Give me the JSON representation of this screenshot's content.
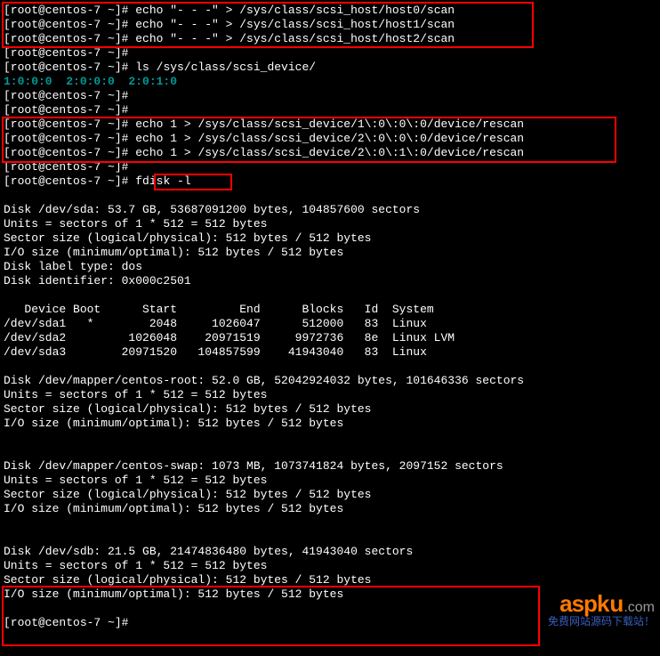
{
  "prompt": {
    "user": "root",
    "host": "centos-7",
    "path": "~",
    "hash": "#"
  },
  "commands": {
    "scan0": "echo \"- - -\" > /sys/class/scsi_host/host0/scan",
    "scan1": "echo \"- - -\" > /sys/class/scsi_host/host1/scan",
    "scan2": "echo \"- - -\" > /sys/class/scsi_host/host2/scan",
    "ls": "ls /sys/class/scsi_device/",
    "ls_output": "1:0:0:0  2:0:0:0  2:0:1:0",
    "rescan0": "echo 1 > /sys/class/scsi_device/1\\:0\\:0\\:0/device/rescan",
    "rescan1": "echo 1 > /sys/class/scsi_device/2\\:0\\:0\\:0/device/rescan",
    "rescan2": "echo 1 > /sys/class/scsi_device/2\\:0\\:1\\:0/device/rescan",
    "fdisk": "fdisk -l"
  },
  "fdisk": {
    "sda": {
      "header": "Disk /dev/sda: 53.7 GB, 53687091200 bytes, 104857600 sectors",
      "units": "Units = sectors of 1 * 512 = 512 bytes",
      "sector": "Sector size (logical/physical): 512 bytes / 512 bytes",
      "io": "I/O size (minimum/optimal): 512 bytes / 512 bytes",
      "label": "Disk label type: dos",
      "ident": "Disk identifier: 0x000c2501"
    },
    "partitions": {
      "header": "   Device Boot      Start         End      Blocks   Id  System",
      "rows": [
        "/dev/sda1   *        2048     1026047      512000   83  Linux",
        "/dev/sda2         1026048    20971519     9972736   8e  Linux LVM",
        "/dev/sda3        20971520   104857599    41943040   83  Linux"
      ]
    },
    "root": {
      "header": "Disk /dev/mapper/centos-root: 52.0 GB, 52042924032 bytes, 101646336 sectors",
      "units": "Units = sectors of 1 * 512 = 512 bytes",
      "sector": "Sector size (logical/physical): 512 bytes / 512 bytes",
      "io": "I/O size (minimum/optimal): 512 bytes / 512 bytes"
    },
    "swap": {
      "header": "Disk /dev/mapper/centos-swap: 1073 MB, 1073741824 bytes, 2097152 sectors",
      "units": "Units = sectors of 1 * 512 = 512 bytes",
      "sector": "Sector size (logical/physical): 512 bytes / 512 bytes",
      "io": "I/O size (minimum/optimal): 512 bytes / 512 bytes"
    },
    "sdb": {
      "header": "Disk /dev/sdb: 21.5 GB, 21474836480 bytes, 41943040 sectors",
      "units": "Units = sectors of 1 * 512 = 512 bytes",
      "sector": "Sector size (logical/physical): 512 bytes / 512 bytes",
      "io": "I/O size (minimum/optimal): 512 bytes / 512 bytes"
    }
  },
  "watermark": {
    "brand": "aspku",
    "suffix": ".com",
    "subtitle": "免费网站源码下载站！"
  }
}
